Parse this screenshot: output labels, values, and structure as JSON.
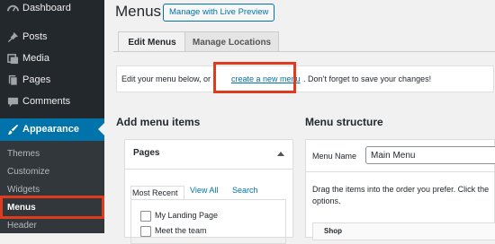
{
  "sidebar": {
    "items": [
      {
        "label": "Dashboard",
        "icon": "dashboard-icon"
      },
      {
        "label": "Posts",
        "icon": "pin-icon"
      },
      {
        "label": "Media",
        "icon": "media-icon"
      },
      {
        "label": "Pages",
        "icon": "page-icon"
      },
      {
        "label": "Comments",
        "icon": "comment-icon"
      },
      {
        "label": "Appearance",
        "icon": "brush-icon"
      }
    ],
    "submenu": [
      "Themes",
      "Customize",
      "Widgets",
      "Menus",
      "Header"
    ]
  },
  "header": {
    "title": "Menus",
    "preview_button": "Manage with Live Preview"
  },
  "tabs": [
    "Edit Menus",
    "Manage Locations"
  ],
  "notice": {
    "before": "Edit your menu below, or ",
    "link": "create a new menu",
    "after": ". Don’t forget to save your changes!"
  },
  "add_items": {
    "heading": "Add menu items",
    "panel_title": "Pages",
    "subtabs": [
      "Most Recent",
      "View All",
      "Search"
    ],
    "pages": [
      "My Landing Page",
      "Meet the team"
    ]
  },
  "structure": {
    "heading": "Menu structure",
    "menu_name_label": "Menu Name",
    "menu_name_value": "Main Menu",
    "help_line1": "Drag the items into the order you prefer. Click the",
    "help_line2": "options.",
    "first_item": "Shop"
  },
  "colors": {
    "sidebar": "#23282d",
    "active": "#0073aa",
    "highlight": "#e03b1f"
  }
}
